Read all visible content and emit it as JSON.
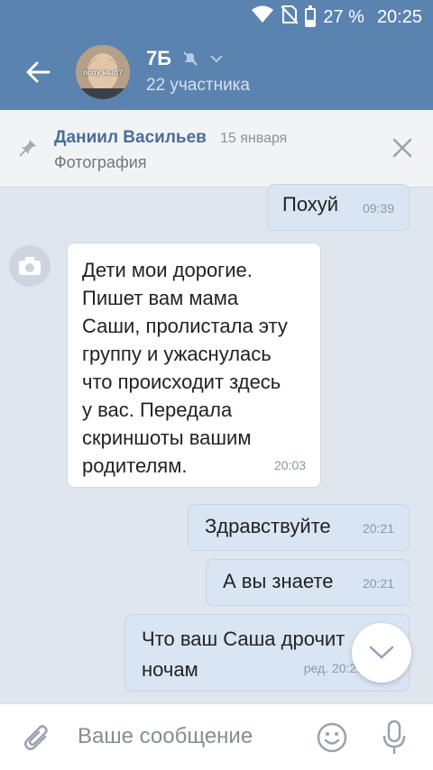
{
  "status_bar": {
    "battery": "27 %",
    "time": "20:25"
  },
  "header": {
    "title": "7Б",
    "subtitle": "22 участника",
    "avatar_caption": "попу мыл?"
  },
  "pinned": {
    "author": "Даниил Васильев",
    "date": "15 января",
    "content": "Фотография"
  },
  "messages": [
    {
      "direction": "out",
      "text": "Похуй",
      "time": "09:39"
    },
    {
      "direction": "in",
      "lines": [
        "Дети мои дорогие.",
        "Пишет вам мама",
        "Саши, пролистала эту",
        "группу и ужаснулась",
        "что происходит здесь",
        "у вас. Передала",
        "скриншоты вашим",
        "родителям."
      ],
      "time": "20:03"
    },
    {
      "direction": "out",
      "text": "Здравствуйте",
      "time": "20:21"
    },
    {
      "direction": "out",
      "text": "А вы знаете",
      "time": "20:21"
    },
    {
      "direction": "out",
      "lines": [
        "Что ваш Саша дрочит",
        "ночам"
      ],
      "time": "ред. 20:21"
    }
  ],
  "composer": {
    "placeholder": "Ваше сообщение"
  },
  "colors": {
    "header": "#5b83b0",
    "chat_bg": "#dfe6ed",
    "outgoing": "#d9e5f3",
    "link": "#4a6e98"
  }
}
